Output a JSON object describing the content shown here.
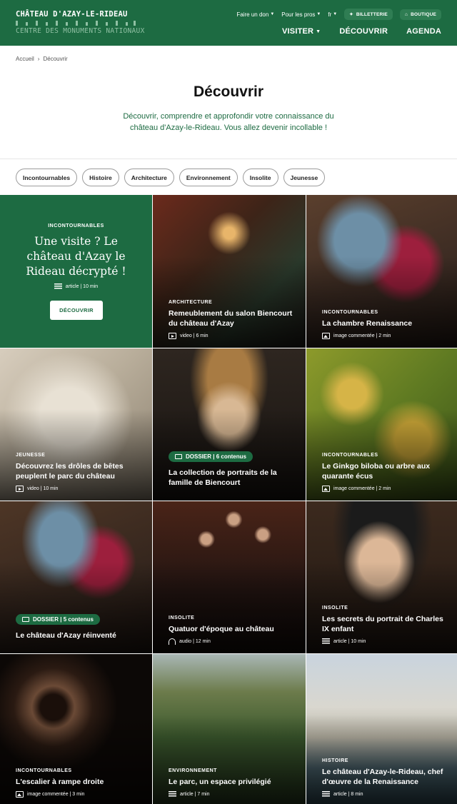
{
  "header": {
    "brand_title": "CHÂTEAU D'AZAY-LE-RIDEAU",
    "brand_subtitle": "CENTRE DES MONUMENTS NATIONAUX",
    "top_links": [
      "Faire un don",
      "Pour les pros",
      "fr"
    ],
    "billetterie": "BILLETTERIE",
    "boutique": "BOUTIQUE",
    "nav": [
      "VISITER",
      "DÉCOUVRIR",
      "AGENDA"
    ]
  },
  "breadcrumb": {
    "home": "Accueil",
    "current": "Découvrir"
  },
  "hero": {
    "title": "Découvrir",
    "intro": "Découvrir, comprendre et approfondir votre connaissance du château d'Azay-le-Rideau. Vous allez devenir incollable !"
  },
  "filters": [
    "Incontournables",
    "Histoire",
    "Architecture",
    "Environnement",
    "Insolite",
    "Jeunesse"
  ],
  "feature": {
    "category": "INCONTOURNABLES",
    "title": "Une visite ? Le château d'Azay le Rideau décrypté !",
    "meta": "article | 10 min",
    "button": "DÉCOUVRIR"
  },
  "cards": [
    {
      "category": "ARCHITECTURE",
      "title": "Remeublement du salon Biencourt du château d'Azay",
      "meta": "video | 6 min",
      "icon": "video-icon"
    },
    {
      "category": "INCONTOURNABLES",
      "title": "La chambre Renaissance",
      "meta": "image commentée | 2 min",
      "icon": "image-icon"
    },
    {
      "category": "JEUNESSE",
      "title": "Découvrez les drôles de bêtes peuplent le parc du château",
      "meta": "video | 10 min",
      "icon": "video-icon"
    },
    {
      "badge": "DOSSIER | 6 contenus",
      "title": "La collection de portraits de la famille de Biencourt"
    },
    {
      "category": "INCONTOURNABLES",
      "title": "Le Ginkgo biloba ou arbre aux quarante écus",
      "meta": "image commentée | 2 min",
      "icon": "image-icon"
    },
    {
      "badge": "DOSSIER | 5 contenus",
      "title": "Le château d'Azay réinventé"
    },
    {
      "category": "INSOLITE",
      "title": "Quatuor d'époque au château",
      "meta": "audio | 12 min",
      "icon": "audio-icon"
    },
    {
      "category": "INSOLITE",
      "title": "Les secrets du portrait de Charles IX enfant",
      "meta": "article | 10 min",
      "icon": "article-icon"
    },
    {
      "category": "INCONTOURNABLES",
      "title": "L'escalier à rampe droite",
      "meta": "image commentée | 3 min",
      "icon": "image-icon"
    },
    {
      "category": "ENVIRONNEMENT",
      "title": "Le parc, un espace privilégié",
      "meta": "article | 7 min",
      "icon": "article-icon"
    },
    {
      "category": "HISTOIRE",
      "title": "Le château d'Azay-le-Rideau, chef d'œuvre de la Renaissance",
      "meta": "article | 8 min",
      "icon": "article-icon"
    }
  ],
  "colors": {
    "brand_green": "#1d6b42",
    "brand_light": "#8fc0a3"
  }
}
